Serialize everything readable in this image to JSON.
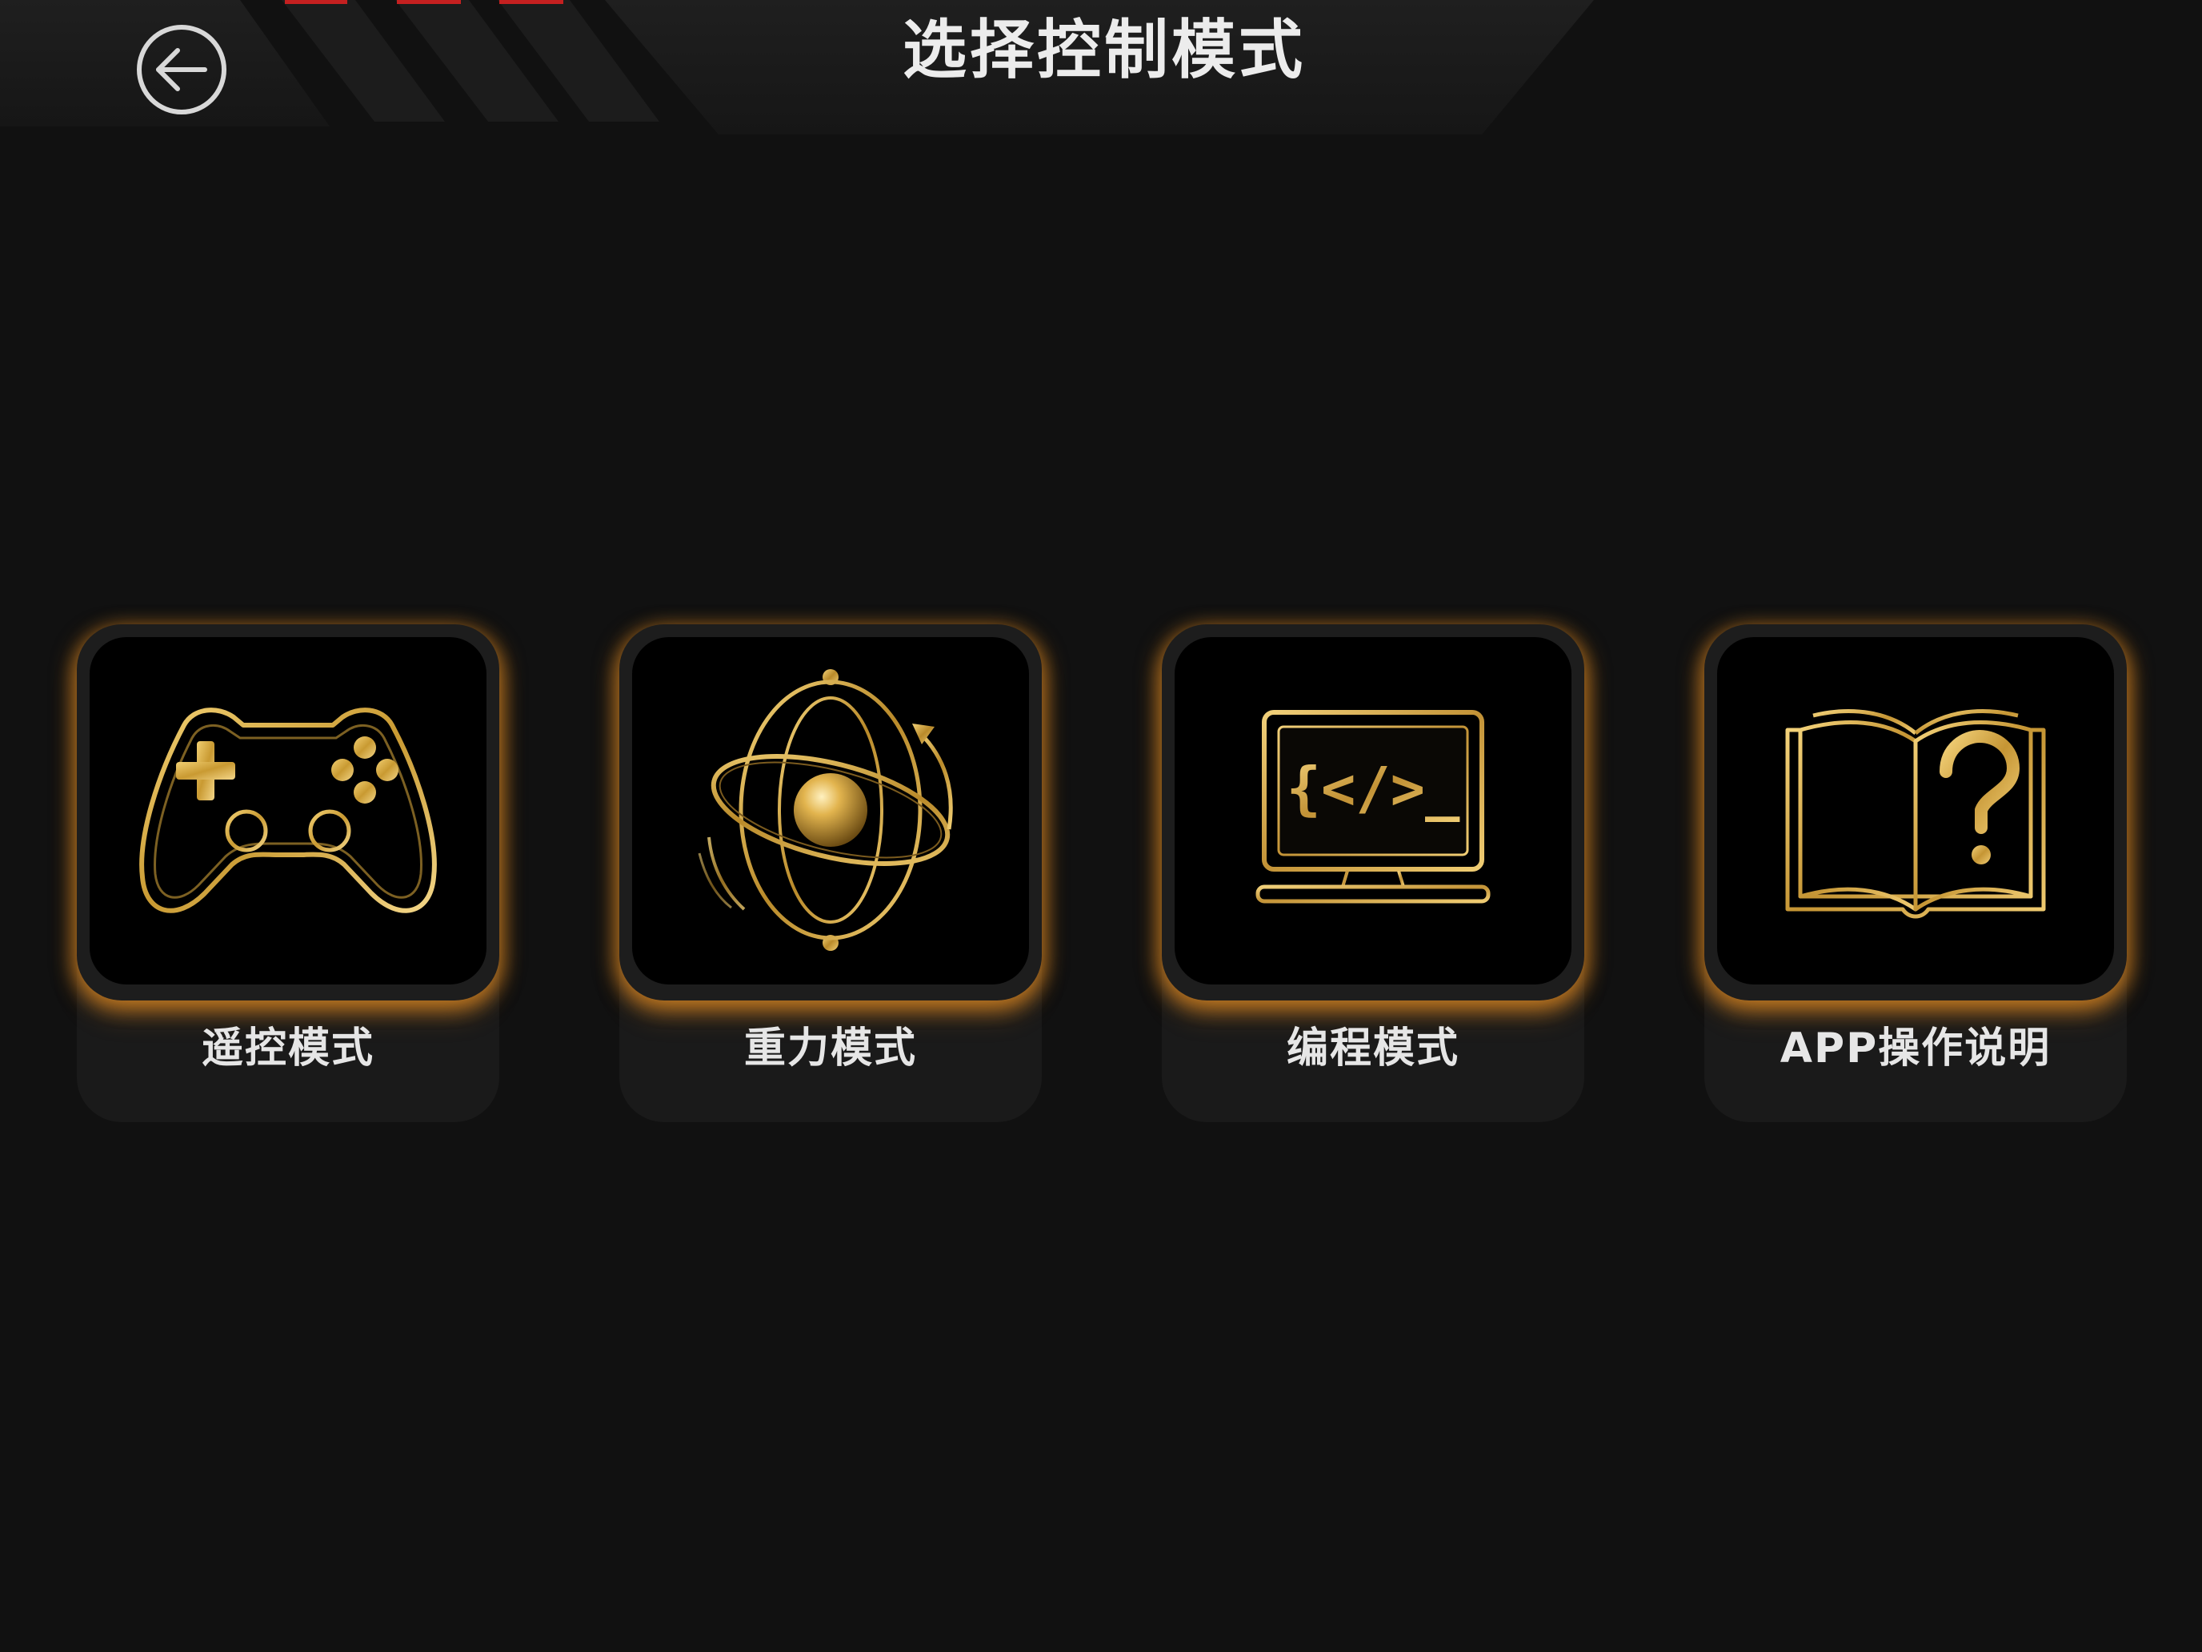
{
  "header": {
    "title": "选择控制模式",
    "back_icon": "arrow-left-circle-icon"
  },
  "colors": {
    "background": "#111111",
    "header_bar": "#1c1c1c",
    "accent_gold": "#d4a640",
    "glow_orange": "#e88e23",
    "stripe_red": "#c42020"
  },
  "modes": [
    {
      "label": "遥控模式",
      "icon": "gamepad-icon"
    },
    {
      "label": "重力模式",
      "icon": "gyroscope-icon"
    },
    {
      "label": "编程模式",
      "icon": "code-monitor-icon"
    },
    {
      "label": "APP操作说明",
      "icon": "help-book-icon"
    }
  ]
}
